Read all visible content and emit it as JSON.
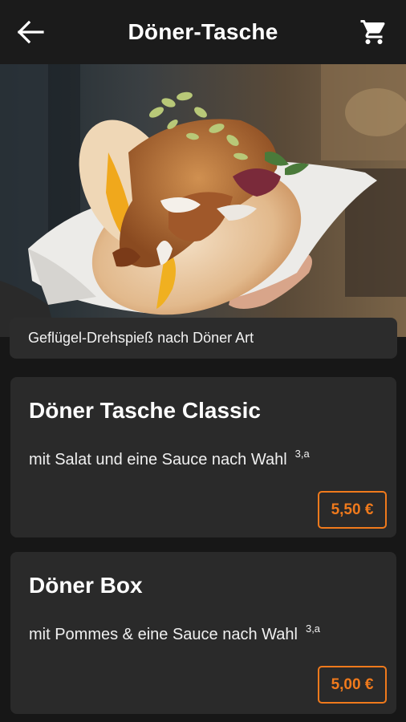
{
  "header": {
    "title": "Döner-Tasche",
    "back_icon": "arrow-left-icon",
    "cart_icon": "cart-icon"
  },
  "hero": {
    "image": "doner-pocket-photo"
  },
  "category": {
    "description": "Geflügel-Drehspieß nach Döner Art"
  },
  "products": [
    {
      "name": "Döner Tasche Classic",
      "description": "mit Salat und eine Sauce nach Wahl",
      "allergens": "3,a",
      "price": "5,50 €"
    },
    {
      "name": "Döner Box",
      "description": "mit Pommes & eine Sauce nach Wahl",
      "allergens": "3,a",
      "price": "5,00 €"
    }
  ],
  "colors": {
    "background": "#171717",
    "card": "#2a2a2a",
    "accent": "#f07a1c"
  }
}
